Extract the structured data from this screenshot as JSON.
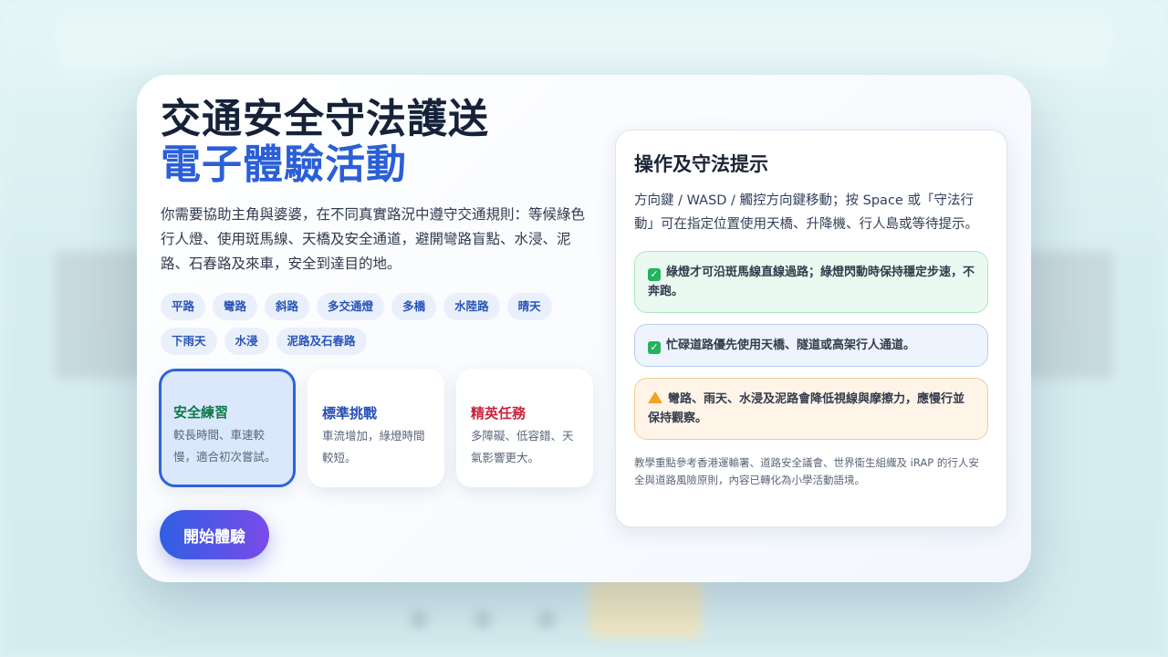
{
  "title": {
    "line1": "交通安全守法護送",
    "line2": "電子體驗活動"
  },
  "description": "你需要協助主角與婆婆，在不同真實路況中遵守交通規則：等候綠色行人燈、使用斑馬線、天橋及安全通道，避開彎路盲點、水浸、泥路、石春路及來車，安全到達目的地。",
  "tags": [
    "平路",
    "彎路",
    "斜路",
    "多交通燈",
    "多橋",
    "水陸路",
    "晴天",
    "下雨天",
    "水浸",
    "泥路及石春路"
  ],
  "modes": [
    {
      "name": "安全練習",
      "desc": "較長時間、車速較慢，適合初次嘗試。",
      "color": "#0f7a4a"
    },
    {
      "name": "標準挑戰",
      "desc": "車流增加，綠燈時間較短。",
      "color": "#2a4fb5"
    },
    {
      "name": "精英任務",
      "desc": "多障礙、低容錯、天氣影響更大。",
      "color": "#c8243b"
    }
  ],
  "start_label": "開始體驗",
  "tips": {
    "title": "操作及守法提示",
    "body": "方向鍵 / WASD / 觸控方向鍵移動；按 Space 或「守法行動」可在指定位置使用天橋、升降機、行人島或等待提示。",
    "notes": [
      {
        "icon": "check-icon",
        "text": "綠燈才可沿斑馬線直線過路；綠燈閃動時保持穩定步速，不奔跑。"
      },
      {
        "icon": "check-icon",
        "text": "忙碌道路優先使用天橋、隧道或高架行人通道。"
      },
      {
        "icon": "warning-icon",
        "text": "彎路、雨天、水浸及泥路會降低視線與摩擦力，應慢行並保持觀察。"
      }
    ],
    "footnote": "教學重點參考香港運輸署、道路安全議會、世界衞生組織及 iRAP 的行人安全與道路風險原則，內容已轉化為小學活動語境。"
  },
  "colors": {
    "accent": "#2b5fd6",
    "title": "#152238",
    "start_gradient_from": "#2f5fe3",
    "start_gradient_to": "#7b4be8"
  }
}
